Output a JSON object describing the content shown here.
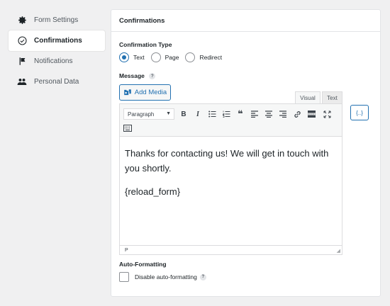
{
  "sidebar": {
    "items": [
      {
        "label": "Form Settings",
        "icon": "gear-icon"
      },
      {
        "label": "Confirmations",
        "icon": "check-circle-icon"
      },
      {
        "label": "Notifications",
        "icon": "flag-icon"
      },
      {
        "label": "Personal Data",
        "icon": "users-icon"
      }
    ]
  },
  "panel": {
    "title": "Confirmations",
    "confirmation_type_label": "Confirmation Type",
    "types": [
      "Text",
      "Page",
      "Redirect"
    ],
    "selected_type": "Text",
    "message_label": "Message",
    "help_mark": "?",
    "add_media_label": "Add Media",
    "tabs": [
      "Visual",
      "Text"
    ],
    "merge_tag_label": "{..}",
    "format_select": "Paragraph",
    "content_lines": [
      "Thanks for contacting us! We will get in touch with you shortly.",
      "{reload_form}"
    ],
    "status_path": "P",
    "auto_formatting_label": "Auto-Formatting",
    "disable_autoformat_label": "Disable auto-formatting"
  },
  "colors": {
    "accent": "#2271b1",
    "background": "#f0f0f1"
  }
}
